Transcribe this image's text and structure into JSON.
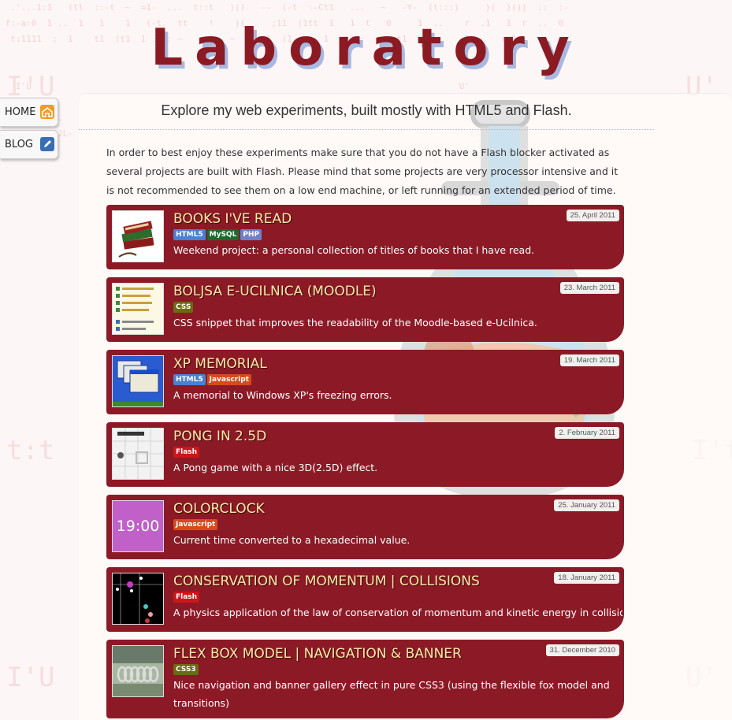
{
  "site": {
    "title": "Laboratory",
    "tagline": "Explore my web experiments, built mostly with HTML5 and Flash.",
    "intro": "In order to best enjoy these experiments make sure that you do not have a Flash blocker activated as several projects are built with Flash. Please mind that some projects are very processor intensive and it is not recommended to see them on a low end machine, or left running for an extended period of time."
  },
  "nav": [
    {
      "label": "HOME",
      "icon": "home-icon",
      "icon_color": "#f39a2b"
    },
    {
      "label": "BLOG",
      "icon": "blog-icon",
      "icon_color": "#3a6db5"
    }
  ],
  "colors": {
    "brand": "#8c1a22",
    "card": "#8c1a26",
    "title_text": "#fde9a8",
    "tag_html5": "#4a7fd4",
    "tag_mysql": "#1d6a2c",
    "tag_php": "#6f80c8",
    "tag_css": "#6b6b10",
    "tag_js": "#d84a1c",
    "tag_flash": "#c81818"
  },
  "projects": [
    {
      "title": "BOOKS I'VE READ",
      "date": "25. April 2011",
      "tags": [
        {
          "label": "HTML5",
          "color": "#4a7fd4"
        },
        {
          "label": "MySQL",
          "color": "#1d6a2c"
        },
        {
          "label": "PHP",
          "color": "#6f80c8"
        }
      ],
      "description": "Weekend project: a personal collection of titles of books that I have read.",
      "thumb": "books-thumbnail"
    },
    {
      "title": "BOLJSA E-UCILNICA (MOODLE)",
      "date": "23. March 2011",
      "tags": [
        {
          "label": "CSS",
          "color": "#6b6b10"
        }
      ],
      "description": "CSS snippet that improves the readability of the Moodle-based e-Ucilnica.",
      "thumb": "moodle-thumbnail"
    },
    {
      "title": "XP MEMORIAL",
      "date": "19. March 2011",
      "tags": [
        {
          "label": "HTML5",
          "color": "#4a7fd4"
        },
        {
          "label": "Javascript",
          "color": "#d84a1c"
        }
      ],
      "description": "A memorial to Windows XP's freezing errors.",
      "thumb": "xp-thumbnail"
    },
    {
      "title": "PONG IN 2.5D",
      "date": "2. February 2011",
      "tags": [
        {
          "label": "Flash",
          "color": "#c81818"
        }
      ],
      "description": "A Pong game with a nice 3D(2.5D) effect.",
      "thumb": "pong-thumbnail"
    },
    {
      "title": "COLORCLOCK",
      "date": "25. January 2011",
      "tags": [
        {
          "label": "Javascript",
          "color": "#d84a1c"
        }
      ],
      "description": "Current time converted to a hexadecimal value.",
      "thumb": "colorclock-thumbnail",
      "thumb_text": "19:00"
    },
    {
      "title": "CONSERVATION OF MOMENTUM | COLLISIONS",
      "date": "18. January 2011",
      "tags": [
        {
          "label": "Flash",
          "color": "#c81818"
        }
      ],
      "description": "A physics application of the law of conservation of momentum and kinetic energy in collisions.",
      "thumb": "collisions-thumbnail"
    },
    {
      "title": "FLEX BOX MODEL | NAVIGATION & BANNER",
      "date": "31. December 2010",
      "tags": [
        {
          "label": "CSS3",
          "color": "#6b6b10"
        }
      ],
      "description": "Nice navigation and banner gallery effect in pure CSS3 (using the flexible fox model and transitions)",
      "thumb": "flexbox-thumbnail"
    }
  ]
}
